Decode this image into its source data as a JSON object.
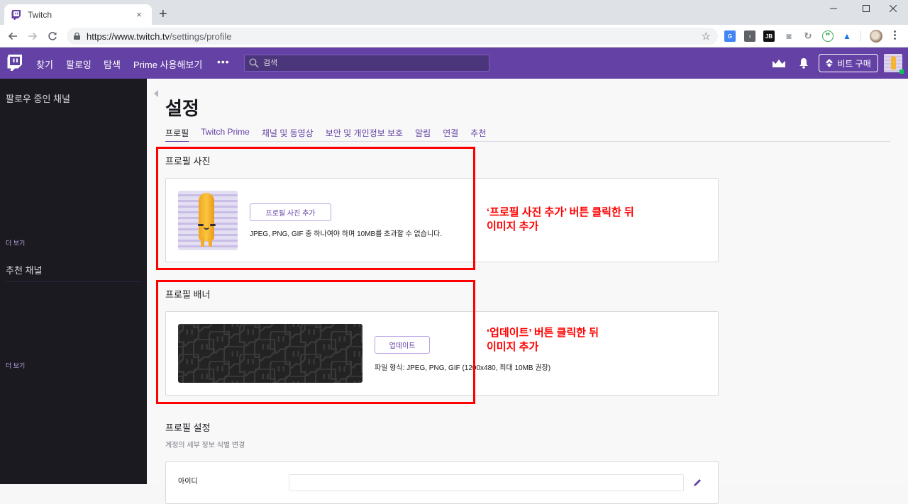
{
  "browser": {
    "tab_title": "Twitch",
    "tab_close": "×",
    "new_tab": "+",
    "url_host": "https://www.twitch.tv",
    "url_path": "/settings/profile",
    "extensions": [
      {
        "name": "google-translate",
        "label": "G",
        "color": "#4285f4"
      },
      {
        "name": "keep",
        "label": "♀",
        "color": "#5f6368"
      },
      {
        "name": "jetbrains",
        "label": "JB",
        "color": "#111111"
      },
      {
        "name": "screenshot",
        "label": "◙",
        "color": "#9aa0a6"
      },
      {
        "name": "sync",
        "label": "↻",
        "color": "#9aa0a6"
      },
      {
        "name": "hangouts",
        "label": "❞",
        "color": "#34a853"
      },
      {
        "name": "cast",
        "label": "▲",
        "color": "#1a73e8"
      }
    ]
  },
  "topnav": {
    "links": [
      "찾기",
      "팔로잉",
      "탐색",
      "Prime 사용해보기"
    ],
    "more": "•••",
    "search_placeholder": "검색",
    "bits_label": "비트 구매"
  },
  "sidebar": {
    "followed_heading": "팔로우 중인 채널",
    "followed_more": "더 보기",
    "recommended_heading": "추천 채널",
    "recommended_more": "더 보기"
  },
  "settings": {
    "title": "설정",
    "tabs": [
      {
        "label": "프로필",
        "active": true
      },
      {
        "label": "Twitch Prime",
        "active": false
      },
      {
        "label": "채널 및 동영상",
        "active": false
      },
      {
        "label": "보안 및 개인정보 보호",
        "active": false
      },
      {
        "label": "알림",
        "active": false
      },
      {
        "label": "연결",
        "active": false
      },
      {
        "label": "추천",
        "active": false
      }
    ],
    "profile_picture": {
      "heading": "프로필 사진",
      "button": "프로필 사진 추가",
      "help": "JPEG, PNG, GIF 중 하나여야 하며 10MB를 초과할 수 없습니다."
    },
    "profile_banner": {
      "heading": "프로필 배너",
      "button": "업데이트",
      "help": "파일 형식: JPEG, PNG, GIF (1200x480, 최대 10MB 권장)"
    },
    "profile_settings": {
      "heading": "프로필 설정",
      "subtext": "계정의 세부 정보 식별 변경",
      "username_label": "아이디",
      "username_value": ""
    }
  },
  "annotations": {
    "picture_note": "‘프로필 사진 추가’ 버튼 클릭한 뒤\n이미지 추가",
    "banner_note": "‘업데이트’ 버튼 클릭한 뒤\n이미지 추가",
    "color": "#ff0000"
  },
  "colors": {
    "brand": "#6441a4",
    "sidebar": "#1c1a21",
    "online": "#00c957"
  }
}
